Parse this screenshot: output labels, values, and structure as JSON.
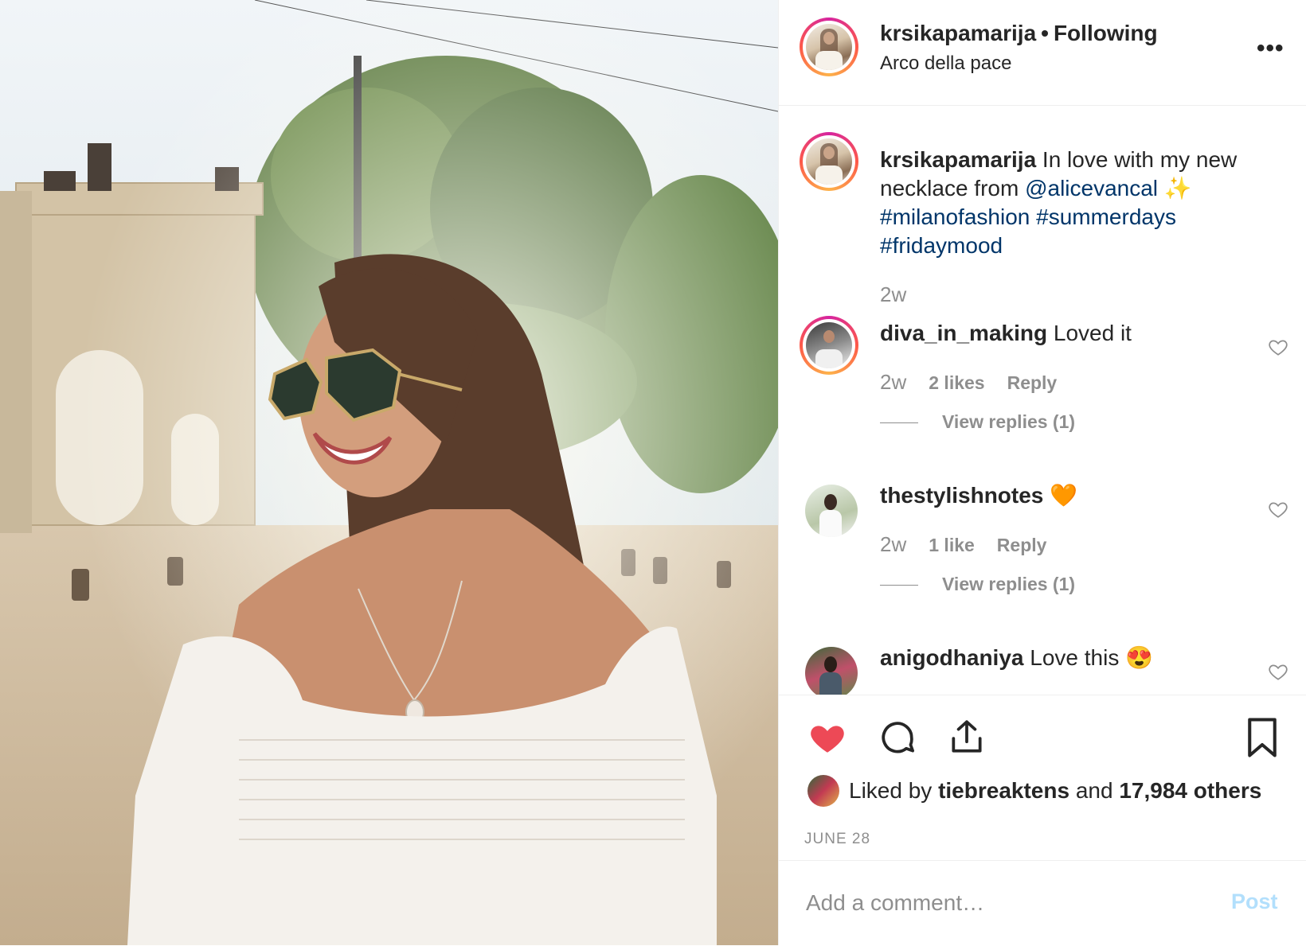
{
  "post": {
    "photo_icon": "portrait-photo",
    "username": "krsikapamarija",
    "separator": "•",
    "follow_status": "Following",
    "location": "Arco della pace",
    "more_icon": "ellipsis-icon",
    "more_label": "•••"
  },
  "caption": {
    "username": "krsikapamarija",
    "text_before": " In love with my new necklace from ",
    "mention": "@alicevancal",
    "sparkles": " ✨",
    "hashtags": [
      "#milanofashion",
      "#summerdays",
      "#fridaymood"
    ],
    "time": "2w"
  },
  "comments": [
    {
      "username": "diva_in_making",
      "text": " Loved it",
      "time": "2w",
      "likes": "2 likes",
      "reply": "Reply",
      "view_replies": "View replies (1)"
    },
    {
      "username": "thestylishnotes",
      "text": " 🧡",
      "time": "2w",
      "likes": "1 like",
      "reply": "Reply",
      "view_replies": "View replies (1)"
    },
    {
      "username": "anigodhaniya",
      "text": " Love this 😍"
    }
  ],
  "actions": {
    "like_icon": "heart-filled-icon",
    "comment_icon": "speech-bubble-icon",
    "share_icon": "share-upload-icon",
    "save_icon": "bookmark-icon",
    "liked_by_prefix": "Liked by ",
    "liked_by_user": "tiebreaktens",
    "liked_by_middle": " and ",
    "liked_by_count": "17,984 others",
    "date": "JUNE 28"
  },
  "comment_box": {
    "placeholder": "Add a comment…",
    "post_label": "Post"
  },
  "colors": {
    "heart": "#ed4956",
    "link": "#003569",
    "secondary": "#8e8e8e",
    "post_disabled": "#b2dffc"
  }
}
